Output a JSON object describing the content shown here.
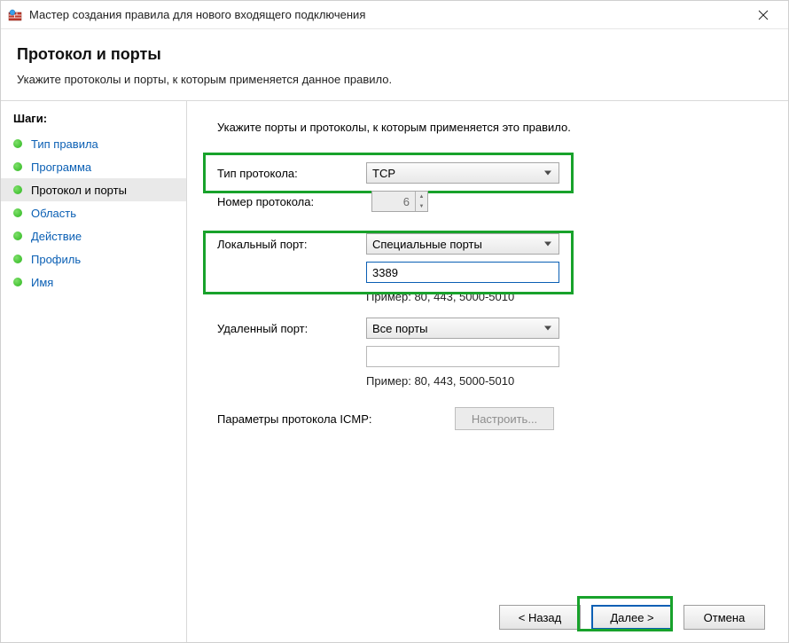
{
  "window": {
    "title": "Мастер создания правила для нового входящего подключения"
  },
  "header": {
    "title": "Протокол и порты",
    "subtitle": "Укажите протоколы и порты, к которым применяется данное правило."
  },
  "steps": {
    "heading": "Шаги:",
    "items": [
      {
        "label": "Тип правила",
        "selected": false
      },
      {
        "label": "Программа",
        "selected": false
      },
      {
        "label": "Протокол и порты",
        "selected": true
      },
      {
        "label": "Область",
        "selected": false
      },
      {
        "label": "Действие",
        "selected": false
      },
      {
        "label": "Профиль",
        "selected": false
      },
      {
        "label": "Имя",
        "selected": false
      }
    ]
  },
  "content": {
    "instruction": "Укажите порты и протоколы, к которым применяется это правило.",
    "protocol_type_label": "Тип протокола:",
    "protocol_type_value": "TCP",
    "protocol_number_label": "Номер протокола:",
    "protocol_number_value": "6",
    "local_port_label": "Локальный порт:",
    "local_port_mode": "Специальные порты",
    "local_port_value": "3389",
    "local_port_example": "Пример: 80, 443, 5000-5010",
    "remote_port_label": "Удаленный порт:",
    "remote_port_mode": "Все порты",
    "remote_port_value": "",
    "remote_port_example": "Пример: 80, 443, 5000-5010",
    "icmp_label": "Параметры протокола ICMP:",
    "icmp_button": "Настроить..."
  },
  "buttons": {
    "back": "< Назад",
    "next": "Далее >",
    "cancel": "Отмена"
  }
}
